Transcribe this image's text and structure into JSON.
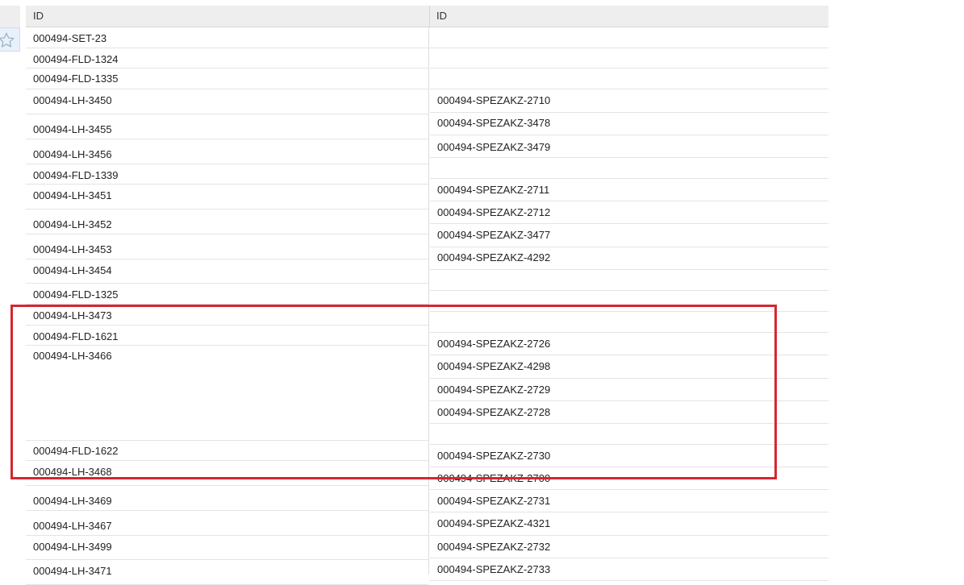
{
  "grid": {
    "columns": [
      "ID",
      "ID"
    ],
    "left_rows": [
      {
        "text": "000494-SET-23"
      },
      {
        "text": "000494-FLD-1324"
      },
      {
        "text": "000494-FLD-1335"
      },
      {
        "text": "000494-LH-3450"
      },
      {
        "text": "000494-LH-3455"
      },
      {
        "text": "000494-LH-3456"
      },
      {
        "text": "000494-FLD-1339"
      },
      {
        "text": "000494-LH-3451"
      },
      {
        "text": "000494-LH-3452"
      },
      {
        "text": "000494-LH-3453"
      },
      {
        "text": "000494-LH-3454"
      },
      {
        "text": "000494-FLD-1325"
      },
      {
        "text": "000494-LH-3473"
      },
      {
        "text": "000494-FLD-1621"
      },
      {
        "text": "000494-LH-3466"
      },
      {
        "text": "000494-FLD-1622"
      },
      {
        "text": "000494-LH-3468"
      },
      {
        "text": "000494-LH-3469"
      },
      {
        "text": "000494-LH-3467"
      },
      {
        "text": "000494-LH-3499"
      },
      {
        "text": "000494-LH-3471"
      }
    ],
    "right_rows": [
      {
        "text": ""
      },
      {
        "text": ""
      },
      {
        "text": ""
      },
      {
        "text": "000494-SPEZAKZ-2710"
      },
      {
        "text": "000494-SPEZAKZ-3478"
      },
      {
        "text": "000494-SPEZAKZ-3479"
      },
      {
        "text": ""
      },
      {
        "text": "000494-SPEZAKZ-2711"
      },
      {
        "text": "000494-SPEZAKZ-2712"
      },
      {
        "text": "000494-SPEZAKZ-3477"
      },
      {
        "text": "000494-SPEZAKZ-4292"
      },
      {
        "text": ""
      },
      {
        "text": ""
      },
      {
        "text": ""
      },
      {
        "text": "000494-SPEZAKZ-2726"
      },
      {
        "text": "000494-SPEZAKZ-4298"
      },
      {
        "text": "000494-SPEZAKZ-2729"
      },
      {
        "text": "000494-SPEZAKZ-2728"
      },
      {
        "text": ""
      },
      {
        "text": "000494-SPEZAKZ-2730"
      },
      {
        "text": "000494-SPEZAKZ-2700"
      },
      {
        "text": "000494-SPEZAKZ-2731"
      },
      {
        "text": "000494-SPEZAKZ-4321"
      },
      {
        "text": "000494-SPEZAKZ-2732"
      },
      {
        "text": "000494-SPEZAKZ-2733"
      }
    ]
  },
  "sidebar": {
    "favorite_icon": "star-outline-icon"
  },
  "annotation": {
    "color": "#d6262f"
  }
}
